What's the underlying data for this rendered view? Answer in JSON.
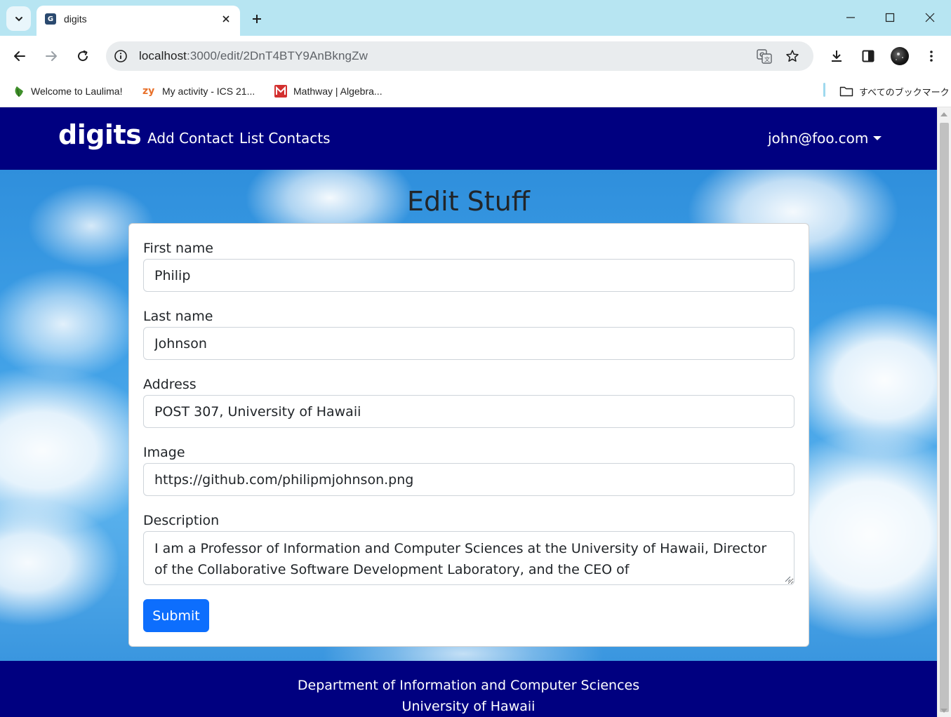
{
  "browser": {
    "tab": {
      "title": "digits"
    },
    "omnibox": {
      "host": "localhost",
      "path": ":3000/edit/2DnT4BTY9AnBkngZw"
    },
    "bookmarks": [
      {
        "label": "Welcome to Laulima!"
      },
      {
        "label": "My activity - ICS 21..."
      },
      {
        "label": "Mathway | Algebra..."
      }
    ],
    "all_bookmarks": {
      "label": "すべてのブックマーク"
    }
  },
  "navbar": {
    "brand": "digits",
    "links": [
      {
        "label": "Add Contact"
      },
      {
        "label": "List Contacts"
      }
    ],
    "user": "john@foo.com"
  },
  "page": {
    "title": "Edit Stuff"
  },
  "form": {
    "first_name": {
      "label": "First name",
      "value": "Philip"
    },
    "last_name": {
      "label": "Last name",
      "value": "Johnson"
    },
    "address": {
      "label": "Address",
      "value": "POST 307, University of Hawaii"
    },
    "image": {
      "label": "Image",
      "value": "https://github.com/philipmjohnson.png"
    },
    "description": {
      "label": "Description",
      "value": "I am a Professor of Information and Computer Sciences at the University of Hawaii, Director of the Collaborative Software Development Laboratory, and the CEO of OpenPowerQuality.com."
    },
    "submit_label": "Submit"
  },
  "footer": {
    "line1": "Department of Information and Computer Sciences",
    "line2": "University of Hawaii"
  },
  "colors": {
    "navbar_bg": "#000080",
    "primary_button": "#0d6efd",
    "tabstrip": "#b7e5f2"
  }
}
